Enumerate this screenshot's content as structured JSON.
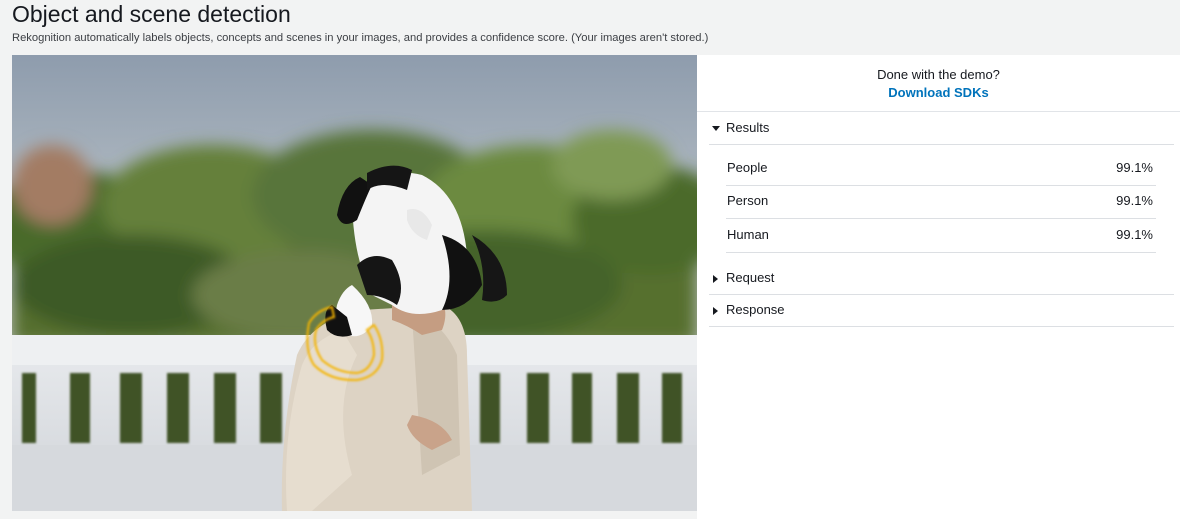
{
  "header": {
    "title": "Object and scene detection",
    "subtitle": "Rekognition automatically labels objects, concepts and scenes in your images, and provides a confidence score. (Your images aren't stored.)"
  },
  "demo": {
    "done_text": "Done with the demo?",
    "download_label": "Download SDKs"
  },
  "sections": {
    "results": "Results",
    "request": "Request",
    "response": "Response"
  },
  "results": [
    {
      "label": "People",
      "value": "99.1%"
    },
    {
      "label": "Person",
      "value": "99.1%"
    },
    {
      "label": "Human",
      "value": "99.1%"
    }
  ],
  "colors": {
    "link": "#0073bb",
    "background": "#f2f3f3",
    "divider": "#dcdfe3",
    "highlight": "#f4b400"
  }
}
